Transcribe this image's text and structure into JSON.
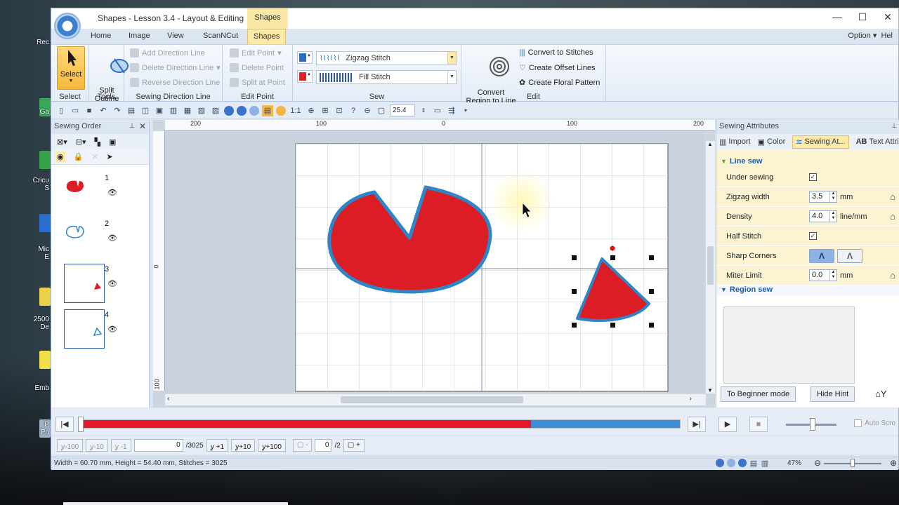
{
  "window": {
    "title": "Shapes - Lesson 3.4 - Layout & Editing",
    "context_tab_header": "Shapes",
    "controls": {
      "minimize": "—",
      "maximize": "☐",
      "close": "✕"
    }
  },
  "desktop_icons": [
    {
      "label": "Rec"
    },
    {
      "label": "Ga"
    },
    {
      "label": "Cricu\nS"
    },
    {
      "label": "Mic\nE"
    },
    {
      "label": "2500\nDe"
    },
    {
      "label": "Emb"
    },
    {
      "label": "P\nPri"
    }
  ],
  "menu_tabs": [
    "Home",
    "Image",
    "View",
    "ScanNCut",
    "Shapes"
  ],
  "active_tab": "Shapes",
  "option_label": "Option",
  "help_label": "Hel",
  "ribbon": {
    "select": {
      "select_label": "Select",
      "group": "Select"
    },
    "tools": {
      "split_outline_label": "Split\nOutline",
      "group": "Tools"
    },
    "sewing_direction": {
      "add": "Add Direction Line",
      "delete": "Delete Direction Line",
      "reverse": "Reverse Direction Line",
      "group": "Sewing Direction Line"
    },
    "edit_point": {
      "edit": "Edit Point",
      "delete": "Delete Point",
      "split": "Split at Point",
      "group": "Edit Point"
    },
    "sew": {
      "line_stitch": "Zigzag Stitch",
      "region_stitch": "Fill Stitch",
      "line_color": "#2b6cc4",
      "region_color": "#d9252a",
      "group": "Sew"
    },
    "edit": {
      "convert_region": "Convert\nRegion to Line",
      "convert_stitches": "Convert to Stitches",
      "offset_lines": "Create Offset Lines",
      "floral_pattern": "Create Floral Pattern",
      "group": "Edit"
    }
  },
  "toolbar": {
    "scale_label": "1:1",
    "zoom_value": "25.4"
  },
  "sewing_order": {
    "title": "Sewing Order",
    "items": [
      {
        "num": "1"
      },
      {
        "num": "2"
      },
      {
        "num": "3"
      },
      {
        "num": "4"
      }
    ]
  },
  "rulers": {
    "h": [
      "200",
      "100",
      "0",
      "100",
      "200"
    ],
    "v": [
      "0",
      "100"
    ]
  },
  "attributes": {
    "title": "Sewing Attributes",
    "tabs": [
      "Import",
      "Color",
      "Sewing At...",
      "Text Attri"
    ],
    "line_sew": "Line sew",
    "under_sewing": {
      "label": "Under sewing",
      "checked": "✓"
    },
    "zigzag_width": {
      "label": "Zigzag width",
      "value": "3.5",
      "unit": "mm"
    },
    "density": {
      "label": "Density",
      "value": "4.0",
      "unit": "line/mm"
    },
    "half_stitch": {
      "label": "Half Stitch",
      "checked": "✓"
    },
    "sharp_corners": {
      "label": "Sharp Corners"
    },
    "miter_limit": {
      "label": "Miter Limit",
      "value": "0.0",
      "unit": "mm"
    },
    "region_sew": "Region sew",
    "beginner_mode": "To Beginner mode",
    "hide_hint": "Hide Hint"
  },
  "playback": {
    "progress_fraction": 0.75,
    "auto_scroll": "Auto Scro"
  },
  "stepbar": {
    "minus100": "-100",
    "minus10": "-10",
    "minus1": "-1",
    "stitch_current": "0",
    "stitch_total": "/3025",
    "plus1": "+1",
    "plus10": "+10",
    "plus100": "+100",
    "color_current": "0",
    "color_total": "/2"
  },
  "status": {
    "text": "Width = 60.70 mm, Height = 54.40 mm, Stitches = 3025",
    "zoom": "47%"
  },
  "colors": {
    "fill_red": "#dc1d25",
    "outline_blue": "#2f86c7",
    "accent": "#fde9a8"
  }
}
